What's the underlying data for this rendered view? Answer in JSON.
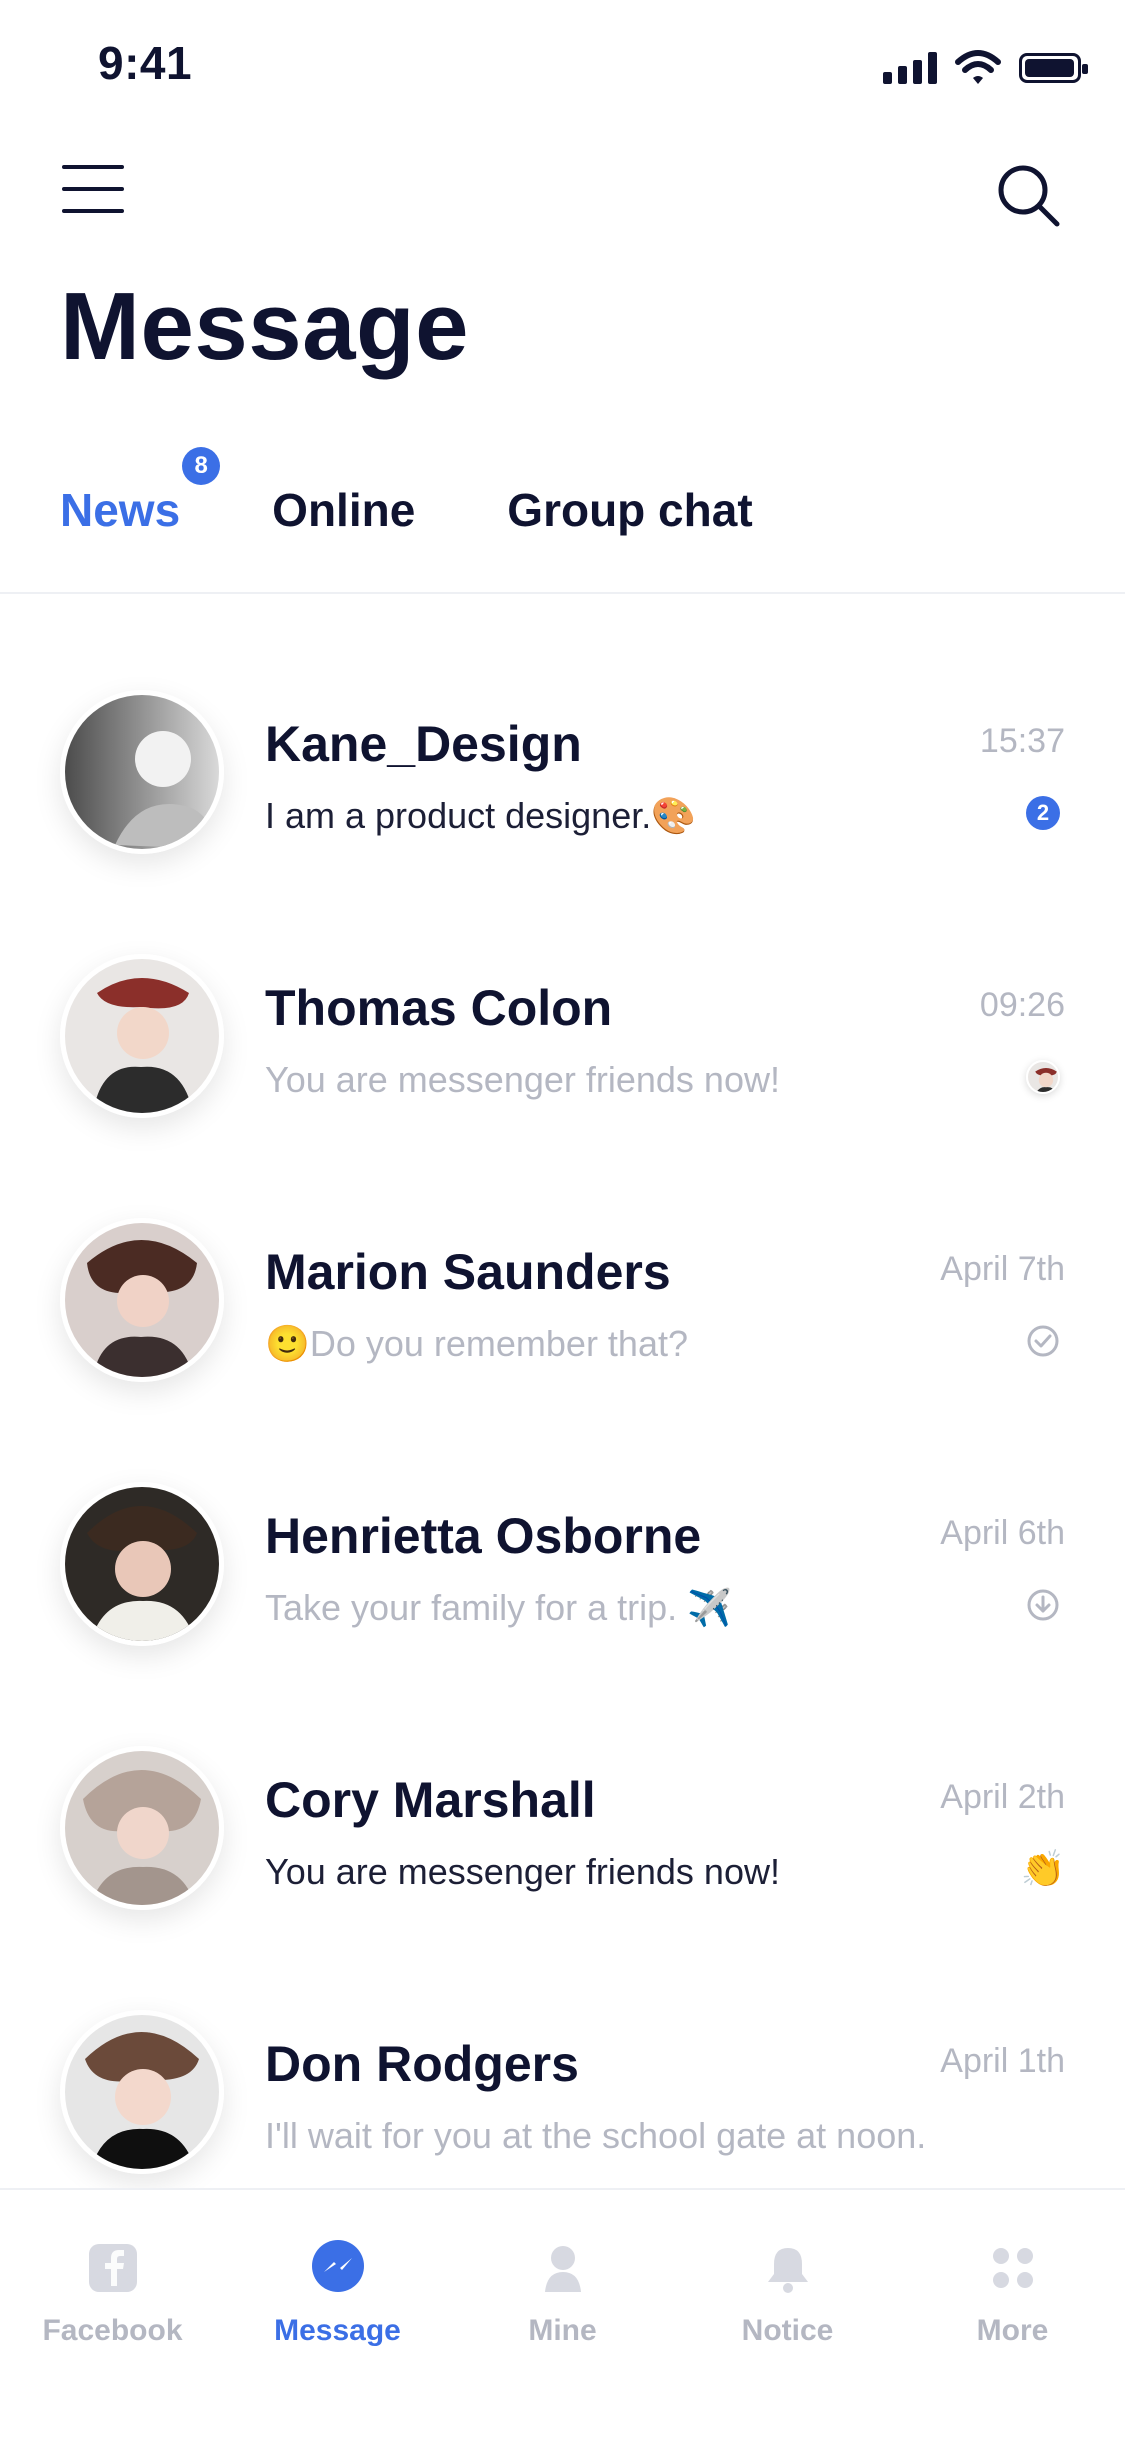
{
  "status_bar": {
    "time": "9:41"
  },
  "header": {
    "title": "Message"
  },
  "tabs": [
    {
      "label": "News",
      "badge": "8",
      "active": true
    },
    {
      "label": "Online",
      "active": false
    },
    {
      "label": "Group chat",
      "active": false
    }
  ],
  "conversations": [
    {
      "name": "Kane_Design",
      "time": "15:37",
      "preview": "I am a product designer.🎨",
      "preview_style": "dark",
      "meta": {
        "type": "unread",
        "value": "2"
      }
    },
    {
      "name": "Thomas Colon",
      "time": "09:26",
      "preview": "You are messenger friends now!",
      "preview_style": "muted",
      "meta": {
        "type": "tiny-avatar"
      }
    },
    {
      "name": "Marion Saunders",
      "time": "April 7th",
      "preview": "🙂Do you remember that?",
      "preview_style": "muted",
      "meta": {
        "type": "check-circle-icon"
      }
    },
    {
      "name": "Henrietta Osborne",
      "time": "April 6th",
      "preview": "Take your family for a trip. ✈️",
      "preview_style": "muted",
      "meta": {
        "type": "download-circle-icon"
      }
    },
    {
      "name": "Cory Marshall",
      "time": "April 2th",
      "preview": "You are messenger friends now!",
      "preview_style": "dark",
      "meta": {
        "type": "clap-emoji",
        "value": "👏"
      }
    },
    {
      "name": "Don Rodgers",
      "time": "April 1th",
      "preview": "I'll wait for you at the school gate at noon.",
      "preview_style": "muted",
      "meta": {
        "type": "none"
      }
    }
  ],
  "bottom_nav": [
    {
      "label": "Facebook",
      "icon": "facebook-icon",
      "active": false
    },
    {
      "label": "Message",
      "icon": "messenger-icon",
      "active": true
    },
    {
      "label": "Mine",
      "icon": "user-icon",
      "active": false
    },
    {
      "label": "Notice",
      "icon": "bell-icon",
      "active": false
    },
    {
      "label": "More",
      "icon": "grid-icon",
      "active": false
    }
  ],
  "colors": {
    "accent": "#3b6fe6",
    "text": "#0f1330",
    "muted": "#b4b7c2"
  }
}
